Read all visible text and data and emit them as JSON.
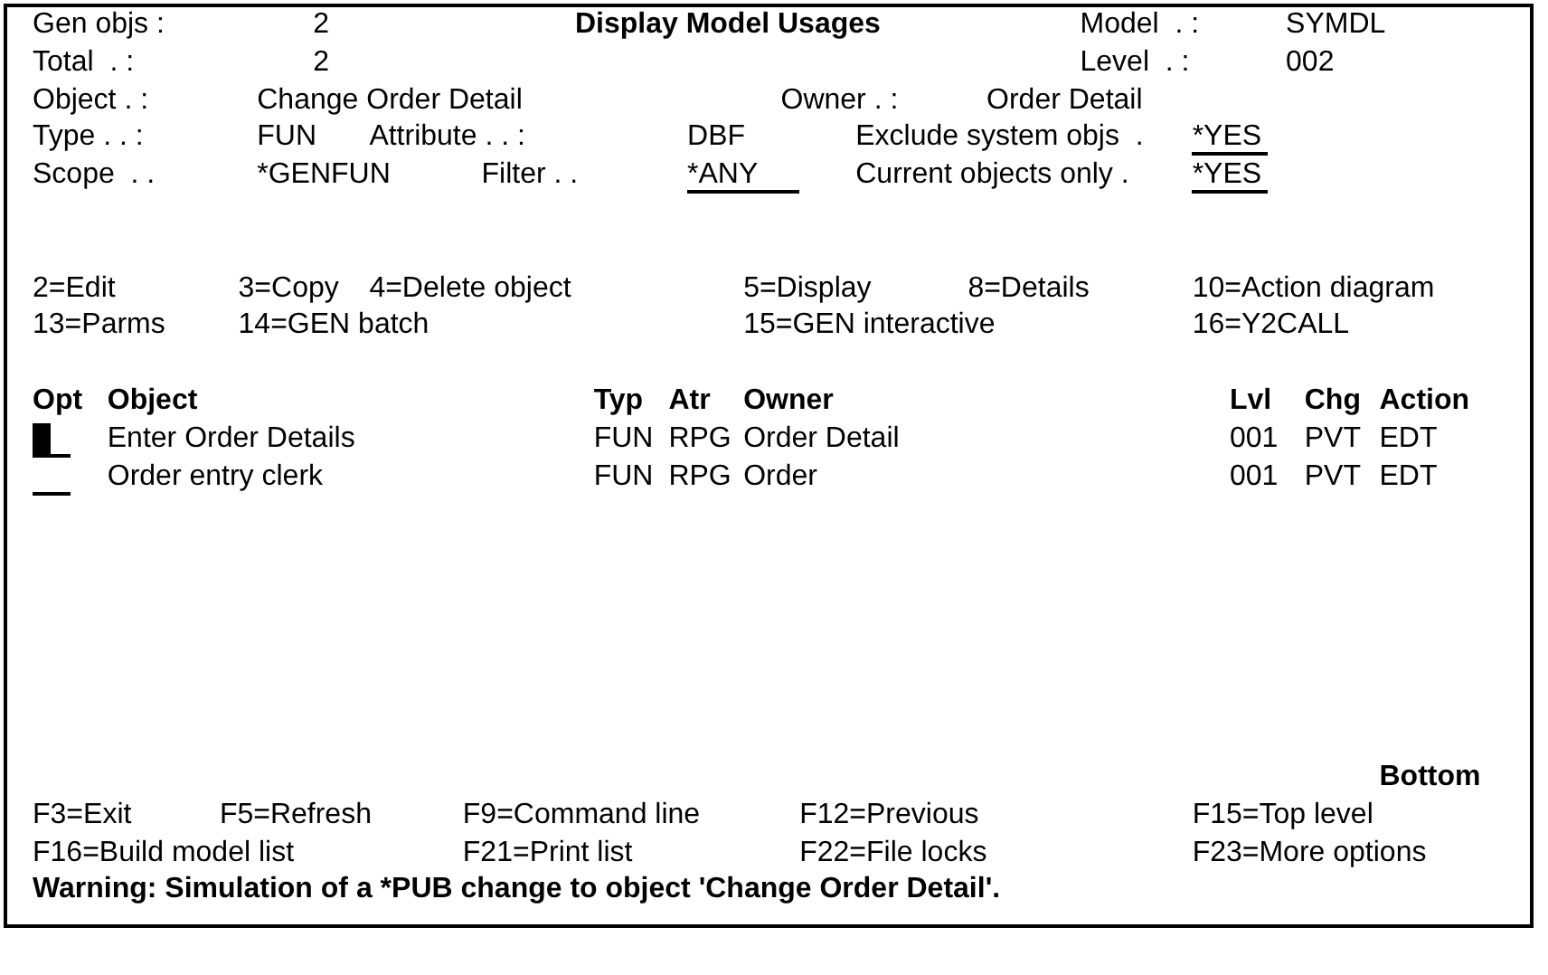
{
  "header": {
    "gen_objs_label": "Gen objs :",
    "gen_objs": "2",
    "title": "Display Model Usages",
    "model_label": "Model  . :",
    "model": "SYMDL",
    "total_label": "Total  . :",
    "total": "2",
    "level_label": "Level  . :",
    "level": "002",
    "object_label": "Object . :",
    "object": "Change Order Detail",
    "owner_label": "Owner . :",
    "owner": "Order Detail",
    "type_label": "Type . . :",
    "type": "FUN",
    "attribute_label": "Attribute . . :",
    "attribute": "DBF",
    "exclude_label": "Exclude system objs  .",
    "exclude": "*YES",
    "scope_label": "Scope  . .",
    "scope": "*GENFUN",
    "filter_label": "Filter . .",
    "filter": "*ANY",
    "current_label": "Current objects only .",
    "current": "*YES"
  },
  "options": [
    [
      "2=Edit",
      "3=Copy",
      "4=Delete object",
      "5=Display",
      "8=Details",
      "10=Action diagram"
    ],
    [
      "13=Parms",
      "14=GEN batch",
      "15=GEN interactive",
      "16=Y2CALL"
    ]
  ],
  "list": {
    "columns": [
      "Opt",
      "Object",
      "Typ",
      "Atr",
      "Owner",
      "Lvl",
      "Chg",
      "Action"
    ],
    "rows": [
      {
        "cursor": true,
        "object": "Enter Order Details",
        "type": "FUN",
        "attribute": "RPG",
        "owner": "Order Detail",
        "level": "001",
        "change": "PVT",
        "action": "EDT"
      },
      {
        "cursor": false,
        "object": "Order entry clerk",
        "type": "FUN",
        "attribute": "RPG",
        "owner": "Order",
        "level": "001",
        "change": "PVT",
        "action": "EDT"
      }
    ],
    "position": "Bottom"
  },
  "function_keys": [
    [
      "F3=Exit",
      "F5=Refresh",
      "F9=Command line",
      "F12=Previous",
      "F15=Top level"
    ],
    [
      "F16=Build model list",
      "F21=Print list",
      "F22=File locks",
      "F23=More options"
    ]
  ],
  "message": "Warning: Simulation of a *PUB change to object 'Change Order Detail'."
}
